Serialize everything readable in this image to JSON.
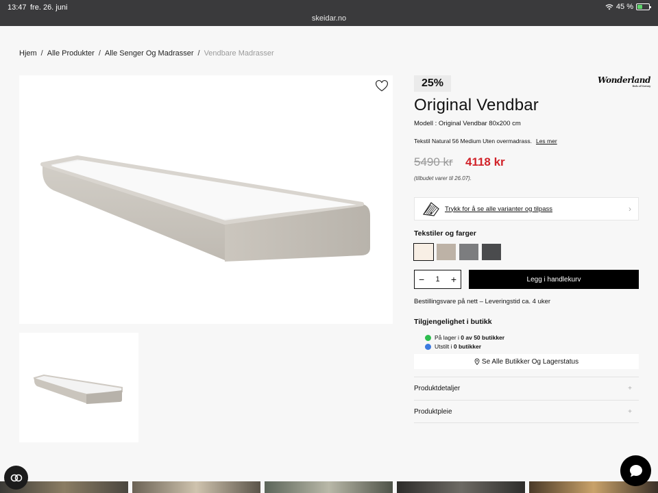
{
  "status_bar": {
    "time": "13:47",
    "date": "fre. 26. juni",
    "battery": "45 %",
    "battery_level": 0.45
  },
  "browser": {
    "url": "skeidar.no"
  },
  "breadcrumb": [
    {
      "label": "Hjem"
    },
    {
      "label": "Alle Produkter"
    },
    {
      "label": "Alle Senger Og Madrasser"
    },
    {
      "label": "Vendbare Madrasser"
    }
  ],
  "product": {
    "discount": "25%",
    "brand": "Wonderland",
    "brand_tagline": "Beds of Norway",
    "title": "Original Vendbar",
    "model": "Modell : Original Vendbar 80x200 cm",
    "description": "Tekstil Natural 56 Medium Uten overmadrass.",
    "read_more": "Les mer",
    "old_price": "5490 kr",
    "new_price": "4118 kr",
    "offer_note": "(tilbudet varer til 26.07).",
    "variants_link": "Trykk for å se alle varianter og tilpass",
    "colors_title": "Tekstiler og farger",
    "colors": [
      "#f8efe5",
      "#bdb2a6",
      "#7c7d7f",
      "#4a4b4d"
    ],
    "quantity": "1",
    "add_to_cart": "Legg i handlekurv",
    "delivery": "Bestillingsvare på nett – Leveringstid ca. 4 uker",
    "availability_title": "Tilgjengelighet i butikk",
    "stock_label": "På lager i",
    "stock_value": "0 av 50 butikker",
    "display_label": "Utstilt i",
    "display_value": "0 butikker",
    "stores_button": "Se Alle Butikker Og Lagerstatus",
    "accordion": [
      {
        "label": "Produktdetaljer"
      },
      {
        "label": "Produktpleie"
      }
    ]
  },
  "colors": {
    "price_red": "#d1232a",
    "stock_green": "#2ebd4f",
    "display_blue": "#3d7be0",
    "button_black": "#000000"
  }
}
